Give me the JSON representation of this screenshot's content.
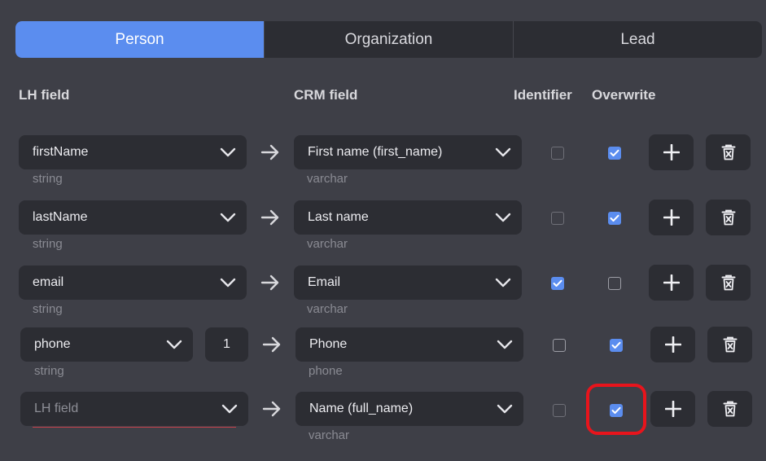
{
  "tabs": [
    {
      "label": "Person",
      "active": true
    },
    {
      "label": "Organization",
      "active": false
    },
    {
      "label": "Lead",
      "active": false
    }
  ],
  "headers": {
    "lh_field": "LH field",
    "crm_field": "CRM field",
    "identifier": "Identifier",
    "overwrite": "Overwrite"
  },
  "rows": [
    {
      "lh_field": "firstName",
      "lh_type": "string",
      "crm_field": "First name (first_name)",
      "crm_type": "varchar",
      "identifier": false,
      "overwrite": true
    },
    {
      "lh_field": "lastName",
      "lh_type": "string",
      "crm_field": "Last name",
      "crm_type": "varchar",
      "identifier": false,
      "overwrite": true
    },
    {
      "lh_field": "email",
      "lh_type": "string",
      "crm_field": "Email",
      "crm_type": "varchar",
      "identifier": true,
      "overwrite": false
    },
    {
      "lh_field": "phone",
      "lh_index": "1",
      "lh_type": "string",
      "crm_field": "Phone",
      "crm_type": "phone",
      "identifier": false,
      "overwrite": true
    },
    {
      "lh_placeholder": "LH field",
      "crm_field": "Name (full_name)",
      "crm_type": "varchar",
      "identifier": false,
      "overwrite": true
    }
  ],
  "colors": {
    "accent": "#5b8def",
    "background": "#3e3f47",
    "control": "#2c2d33",
    "highlight": "#e8141c",
    "error_underline": "#c7414a"
  },
  "icons": {
    "arrow": "arrow-right-icon",
    "chevron": "chevron-down-icon",
    "add": "plus-icon",
    "delete": "trash-icon",
    "check": "checkmark-icon"
  }
}
